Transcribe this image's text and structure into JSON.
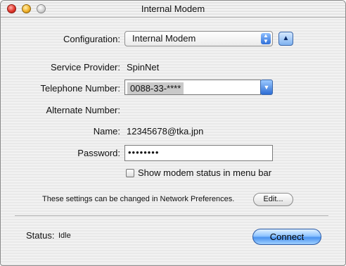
{
  "window": {
    "title": "Internal Modem"
  },
  "configuration": {
    "label": "Configuration:",
    "value": "Internal Modem"
  },
  "service_provider": {
    "label": "Service Provider:",
    "value": "SpinNet"
  },
  "telephone": {
    "label": "Telephone Number:",
    "value": "0088-33-****"
  },
  "alternate": {
    "label": "Alternate Number:",
    "value": ""
  },
  "name": {
    "label": "Name:",
    "value": "12345678@tka.jpn"
  },
  "password": {
    "label": "Password:",
    "value": "••••••••"
  },
  "show_status": {
    "label": "Show modem status in menu bar",
    "checked": false
  },
  "prefs": {
    "text": "These settings can be changed in Network Preferences.",
    "edit_label": "Edit..."
  },
  "status": {
    "label": "Status:",
    "value": "Idle"
  },
  "connect_label": "Connect",
  "colors": {
    "accent": "#4a93ef",
    "window_bg": "#eeeeee"
  },
  "icons": {
    "popup": "up-down-arrows-icon",
    "disclosure": "triangle-up-icon",
    "combo": "triangle-down-icon"
  }
}
